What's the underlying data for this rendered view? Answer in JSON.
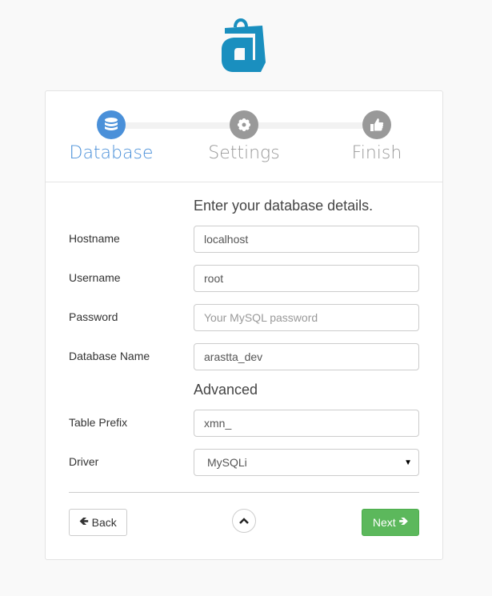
{
  "brand": {
    "logo_icon": "shopping-bag-a-logo",
    "color": "#1a8fbf"
  },
  "steps": [
    {
      "label": "Database",
      "icon": "database-icon",
      "active": true,
      "color": "#4a90d9"
    },
    {
      "label": "Settings",
      "icon": "gear-icon",
      "active": false,
      "color": "#999999"
    },
    {
      "label": "Finish",
      "icon": "thumbs-up-icon",
      "active": false,
      "color": "#999999"
    }
  ],
  "form": {
    "heading": "Enter your database details.",
    "hostname": {
      "label": "Hostname",
      "value": "localhost"
    },
    "username": {
      "label": "Username",
      "value": "root"
    },
    "password": {
      "label": "Password",
      "value": "",
      "placeholder": "Your MySQL password"
    },
    "dbname": {
      "label": "Database Name",
      "value": "arastta_dev"
    },
    "advanced_heading": "Advanced",
    "prefix": {
      "label": "Table Prefix",
      "value": "xmn_"
    },
    "driver": {
      "label": "Driver",
      "value": "MySQLi"
    }
  },
  "footer": {
    "back_label": "Back",
    "next_label": "Next",
    "next_color": "#5cb85c"
  }
}
